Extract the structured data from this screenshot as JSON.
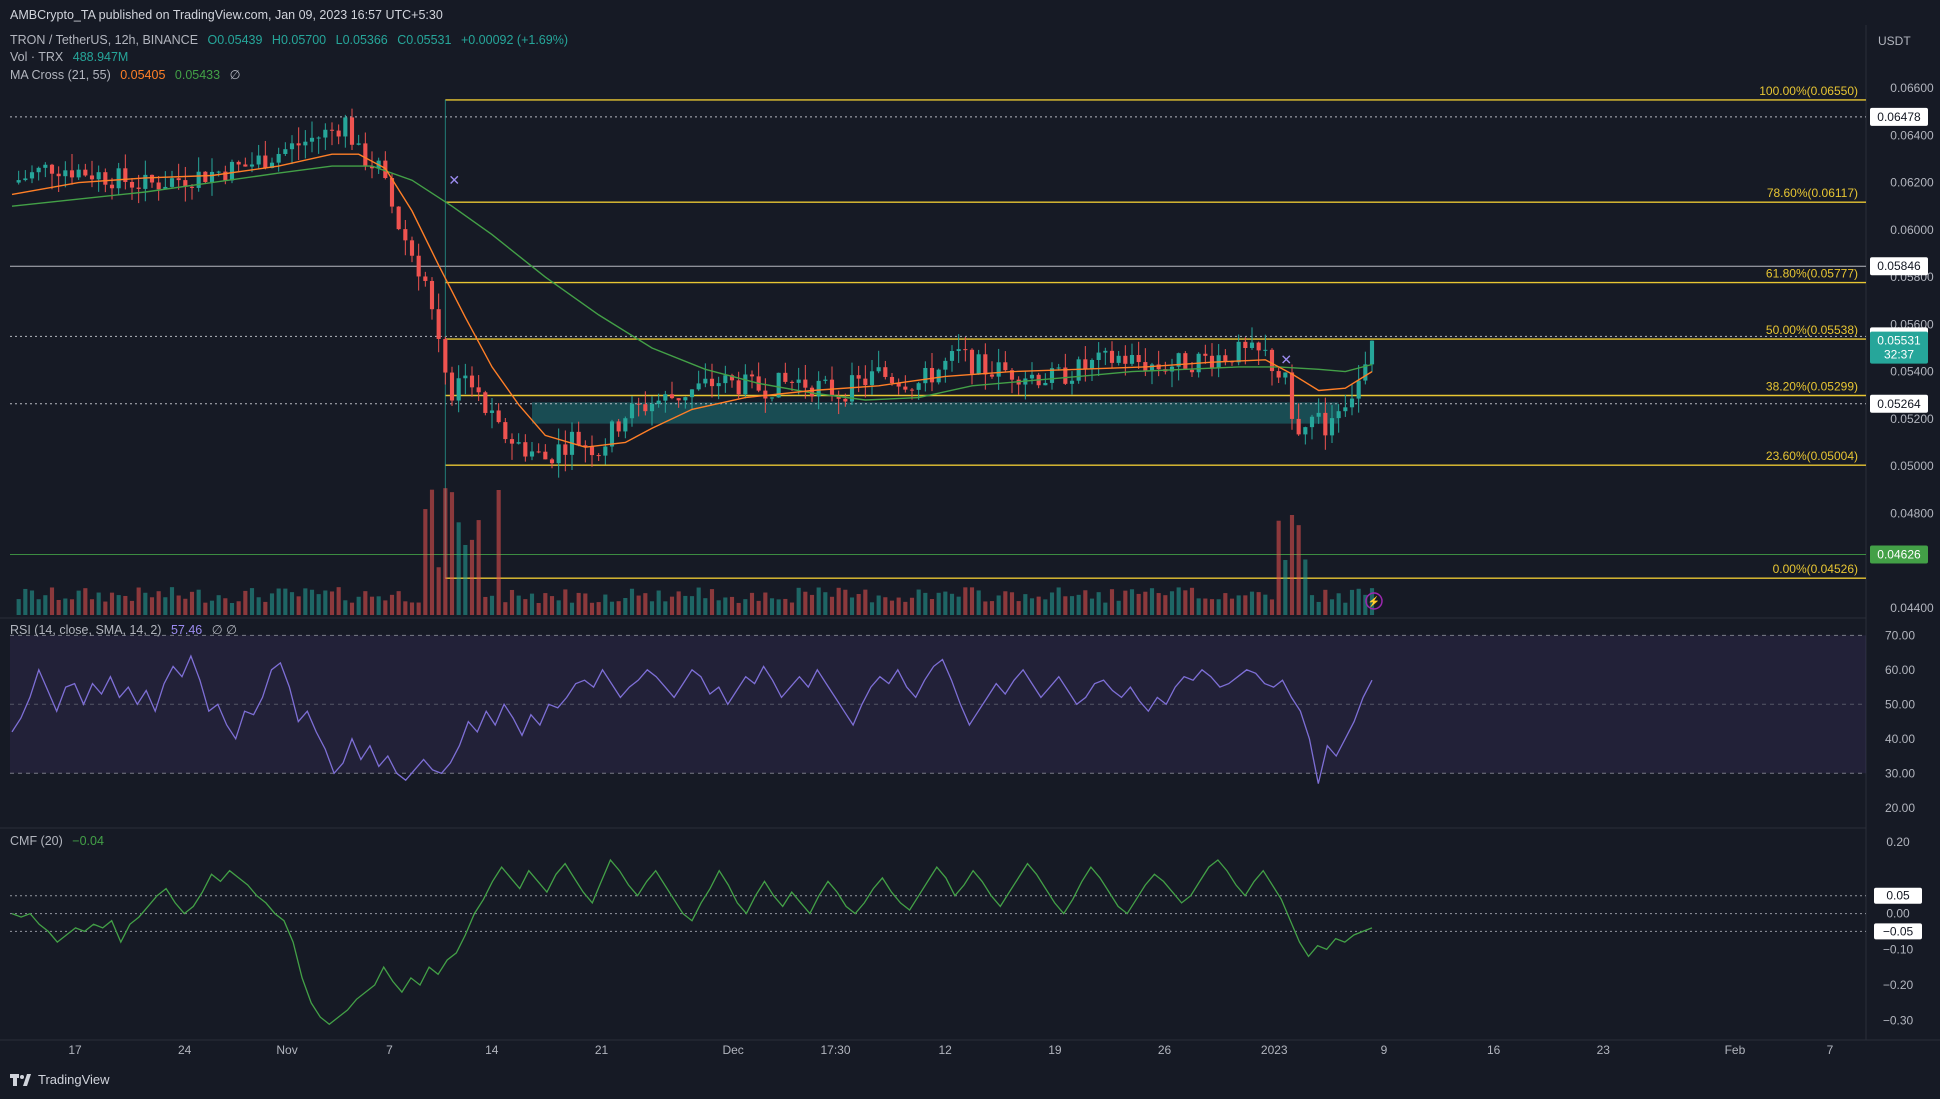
{
  "header": {
    "published": "AMBCrypto_TA published on TradingView.com, Jan 09, 2023 16:57 UTC+5:30",
    "symbol": "TRON / TetherUS, 12h, BINANCE",
    "ohlc": {
      "o": "O0.05439",
      "h": "H0.05700",
      "l": "L0.05366",
      "c": "C0.05531",
      "chg": "+0.00092 (+1.69%)"
    },
    "vol_label": "Vol · TRX",
    "vol_value": "488.947M",
    "ma_label": "MA Cross (21, 55)",
    "ma_fast": "0.05405",
    "ma_slow": "0.05433",
    "ma_extra": "∅",
    "currency": "USDT"
  },
  "indicators": {
    "rsi_label": "RSI (14, close, SMA, 14, 2)",
    "rsi_value": "57.46",
    "rsi_extra": "∅ ∅",
    "cmf_label": "CMF (20)",
    "cmf_value": "−0.04"
  },
  "footer": {
    "brand": "TradingView"
  },
  "colors": {
    "background": "#161a25",
    "up": "#26a69a",
    "down": "#ef5350",
    "fib": "#e8c633",
    "ma_fast": "#ff7f27",
    "ma_slow": "#43a047",
    "rsi": "#7e6fd6",
    "cmf": "#43a047",
    "zone": "#1b5e63"
  },
  "chart_data": [
    {
      "type": "line",
      "name": "price",
      "x_ticks": [
        "17",
        "24",
        "Nov",
        "7",
        "14",
        "21",
        "Dec",
        "17:30",
        "12",
        "19",
        "26",
        "2023",
        "9",
        "16",
        "23",
        "Feb",
        "7"
      ],
      "y_ticks": [
        "0.06600",
        "0.06400",
        "0.06200",
        "0.06000",
        "0.05800",
        "0.05600",
        "0.05400",
        "0.05200",
        "0.05000",
        "0.04800",
        "0.04400"
      ],
      "ylim": [
        0.0437,
        0.0674
      ],
      "last_price": "0.05531",
      "countdown": "32:37",
      "fib_levels": [
        {
          "label": "100.00%(0.06550)",
          "value": 0.0655
        },
        {
          "label": "78.60%(0.06117)",
          "value": 0.06117
        },
        {
          "label": "61.80%(0.05777)",
          "value": 0.05777
        },
        {
          "label": "50.00%(0.05538)",
          "value": 0.05538
        },
        {
          "label": "38.20%(0.05299)",
          "value": 0.05299
        },
        {
          "label": "23.60%(0.05004)",
          "value": 0.05004
        },
        {
          "label": "0.00%(0.04526)",
          "value": 0.04526
        }
      ],
      "horizontal_levels": [
        {
          "label": "0.06478",
          "value": 0.06478,
          "style": "dotted"
        },
        {
          "label": "0.05846",
          "value": 0.05846,
          "style": "solid"
        },
        {
          "label": "0.05549",
          "value": 0.05549,
          "style": "dotted"
        },
        {
          "label": "0.05264",
          "value": 0.05264,
          "style": "dotted"
        },
        {
          "label": "0.04626",
          "value": 0.04626,
          "style": "green"
        }
      ],
      "demand_zone": {
        "low": 0.0518,
        "high": 0.0527
      },
      "close_path": [
        [
          0,
          0.062
        ],
        [
          6,
          0.0627
        ],
        [
          12,
          0.0624
        ],
        [
          20,
          0.0619
        ],
        [
          28,
          0.0623
        ],
        [
          35,
          0.0627
        ],
        [
          42,
          0.0635
        ],
        [
          48,
          0.0642
        ],
        [
          50,
          0.0646
        ],
        [
          52,
          0.0632
        ],
        [
          55,
          0.0626
        ],
        [
          58,
          0.0602
        ],
        [
          60,
          0.059
        ],
        [
          62,
          0.0578
        ],
        [
          64,
          0.0555
        ],
        [
          66,
          0.053
        ],
        [
          68,
          0.0542
        ],
        [
          70,
          0.0528
        ],
        [
          73,
          0.0515
        ],
        [
          76,
          0.0509
        ],
        [
          80,
          0.0503
        ],
        [
          84,
          0.0512
        ],
        [
          88,
          0.0507
        ],
        [
          92,
          0.0522
        ],
        [
          96,
          0.0527
        ],
        [
          100,
          0.053
        ],
        [
          106,
          0.0536
        ],
        [
          112,
          0.0533
        ],
        [
          118,
          0.0536
        ],
        [
          124,
          0.0531
        ],
        [
          130,
          0.0539
        ],
        [
          136,
          0.0535
        ],
        [
          142,
          0.0547
        ],
        [
          146,
          0.0541
        ],
        [
          150,
          0.054
        ],
        [
          156,
          0.0537
        ],
        [
          162,
          0.0543
        ],
        [
          166,
          0.0546
        ],
        [
          172,
          0.0542
        ],
        [
          178,
          0.0545
        ],
        [
          184,
          0.0548
        ],
        [
          188,
          0.0547
        ],
        [
          191,
          0.0535
        ],
        [
          193,
          0.0512
        ],
        [
          195,
          0.0519
        ],
        [
          197,
          0.0517
        ],
        [
          199,
          0.0526
        ],
        [
          201,
          0.0531
        ],
        [
          203,
          0.054
        ],
        [
          204,
          0.0553
        ]
      ],
      "ma_fast_path": [
        [
          0,
          0.0615
        ],
        [
          10,
          0.062
        ],
        [
          20,
          0.0622
        ],
        [
          30,
          0.0623
        ],
        [
          40,
          0.0627
        ],
        [
          48,
          0.0632
        ],
        [
          52,
          0.0632
        ],
        [
          56,
          0.0626
        ],
        [
          60,
          0.0608
        ],
        [
          64,
          0.0585
        ],
        [
          68,
          0.0563
        ],
        [
          72,
          0.0542
        ],
        [
          76,
          0.0526
        ],
        [
          80,
          0.0513
        ],
        [
          86,
          0.0508
        ],
        [
          92,
          0.051
        ],
        [
          96,
          0.0516
        ],
        [
          102,
          0.0524
        ],
        [
          110,
          0.0529
        ],
        [
          120,
          0.0532
        ],
        [
          130,
          0.0534
        ],
        [
          140,
          0.0538
        ],
        [
          150,
          0.054
        ],
        [
          160,
          0.0541
        ],
        [
          170,
          0.0542
        ],
        [
          180,
          0.0544
        ],
        [
          188,
          0.0545
        ],
        [
          192,
          0.0539
        ],
        [
          196,
          0.0532
        ],
        [
          200,
          0.0533
        ],
        [
          204,
          0.054
        ]
      ],
      "ma_slow_path": [
        [
          0,
          0.061
        ],
        [
          10,
          0.0613
        ],
        [
          20,
          0.0616
        ],
        [
          30,
          0.062
        ],
        [
          40,
          0.0624
        ],
        [
          48,
          0.0627
        ],
        [
          54,
          0.0627
        ],
        [
          60,
          0.0621
        ],
        [
          66,
          0.061
        ],
        [
          72,
          0.0598
        ],
        [
          80,
          0.058
        ],
        [
          88,
          0.0564
        ],
        [
          96,
          0.055
        ],
        [
          104,
          0.0541
        ],
        [
          112,
          0.0535
        ],
        [
          120,
          0.0531
        ],
        [
          128,
          0.0528
        ],
        [
          136,
          0.0529
        ],
        [
          144,
          0.0534
        ],
        [
          152,
          0.0536
        ],
        [
          160,
          0.0538
        ],
        [
          168,
          0.054
        ],
        [
          176,
          0.0541
        ],
        [
          184,
          0.0542
        ],
        [
          190,
          0.0542
        ],
        [
          196,
          0.0541
        ],
        [
          200,
          0.054
        ],
        [
          204,
          0.0543
        ]
      ]
    },
    {
      "type": "line",
      "name": "RSI (14, close, SMA, 14, 2)",
      "y_ticks": [
        "70.00",
        "60.00",
        "50.00",
        "40.00",
        "30.00",
        "20.00"
      ],
      "ylim": [
        15,
        73
      ],
      "band": [
        30,
        70
      ],
      "last": 57.46,
      "values": [
        42,
        46,
        52,
        60,
        54,
        48,
        55,
        56,
        50,
        56,
        53,
        58,
        52,
        55,
        50,
        54,
        48,
        56,
        61,
        58,
        64,
        57,
        48,
        50,
        44,
        40,
        48,
        47,
        52,
        60,
        62,
        55,
        45,
        48,
        42,
        37,
        30,
        33,
        40,
        34,
        38,
        32,
        35,
        30,
        28,
        31,
        34,
        31,
        30,
        33,
        38,
        45,
        42,
        48,
        44,
        50,
        46,
        41,
        47,
        44,
        50,
        49,
        52,
        56,
        57,
        55,
        60,
        56,
        52,
        55,
        57,
        60,
        58,
        55,
        52,
        56,
        60,
        58,
        53,
        55,
        50,
        54,
        58,
        56,
        61,
        57,
        52,
        55,
        58,
        55,
        60,
        56,
        52,
        48,
        44,
        50,
        55,
        58,
        56,
        60,
        55,
        52,
        57,
        61,
        63,
        57,
        50,
        44,
        48,
        52,
        56,
        53,
        57,
        60,
        56,
        52,
        55,
        58,
        54,
        50,
        52,
        56,
        57,
        54,
        52,
        55,
        51,
        48,
        52,
        50,
        55,
        58,
        57,
        60,
        58,
        55,
        56,
        58,
        60,
        59,
        56,
        55,
        57,
        52,
        48,
        40,
        27,
        38,
        35,
        40,
        45,
        52,
        57
      ]
    },
    {
      "type": "line",
      "name": "CMF (20)",
      "y_ticks": [
        "0.20",
        "0.05",
        "0.00",
        "−0.05",
        "−0.10",
        "−0.20",
        "−0.30"
      ],
      "ylim": [
        -0.34,
        0.22
      ],
      "reference_lines": [
        0.05,
        0.0,
        -0.05
      ],
      "last": -0.04,
      "values": [
        0.0,
        -0.01,
        0.0,
        -0.03,
        -0.05,
        -0.08,
        -0.06,
        -0.04,
        -0.05,
        -0.03,
        -0.04,
        -0.02,
        -0.08,
        -0.03,
        -0.01,
        0.02,
        0.05,
        0.07,
        0.03,
        0.0,
        0.02,
        0.06,
        0.11,
        0.09,
        0.12,
        0.1,
        0.08,
        0.05,
        0.03,
        0.0,
        -0.02,
        -0.08,
        -0.18,
        -0.25,
        -0.29,
        -0.31,
        -0.29,
        -0.27,
        -0.24,
        -0.22,
        -0.2,
        -0.15,
        -0.19,
        -0.22,
        -0.18,
        -0.2,
        -0.15,
        -0.17,
        -0.13,
        -0.11,
        -0.06,
        0.0,
        0.04,
        0.09,
        0.13,
        0.1,
        0.07,
        0.12,
        0.09,
        0.06,
        0.11,
        0.14,
        0.1,
        0.06,
        0.03,
        0.09,
        0.15,
        0.12,
        0.08,
        0.05,
        0.09,
        0.12,
        0.08,
        0.04,
        0.0,
        -0.02,
        0.03,
        0.07,
        0.12,
        0.08,
        0.03,
        0.0,
        0.05,
        0.09,
        0.05,
        0.02,
        0.06,
        0.03,
        0.0,
        0.05,
        0.09,
        0.06,
        0.02,
        0.0,
        0.03,
        0.07,
        0.1,
        0.06,
        0.03,
        0.01,
        0.05,
        0.09,
        0.13,
        0.1,
        0.05,
        0.08,
        0.12,
        0.09,
        0.05,
        0.02,
        0.06,
        0.1,
        0.14,
        0.11,
        0.07,
        0.03,
        0.0,
        0.04,
        0.09,
        0.13,
        0.1,
        0.06,
        0.02,
        0.0,
        0.04,
        0.08,
        0.11,
        0.09,
        0.06,
        0.03,
        0.05,
        0.09,
        0.13,
        0.15,
        0.12,
        0.08,
        0.05,
        0.09,
        0.12,
        0.08,
        0.04,
        -0.02,
        -0.08,
        -0.12,
        -0.09,
        -0.1,
        -0.07,
        -0.08,
        -0.06,
        -0.05,
        -0.04
      ]
    }
  ]
}
